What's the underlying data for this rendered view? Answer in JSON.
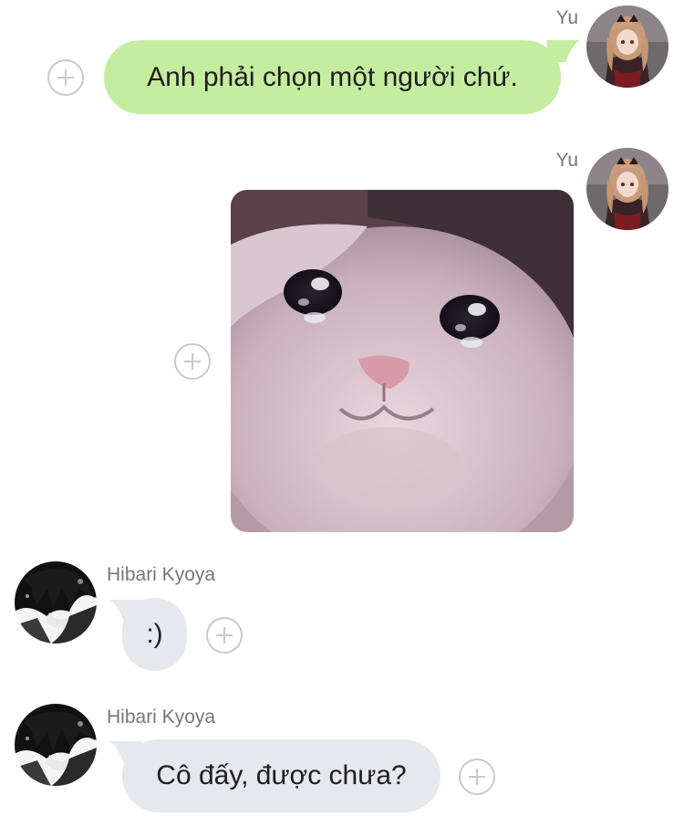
{
  "messages": [
    {
      "sender": "Yu",
      "side": "right",
      "type": "text",
      "text": "Anh phải chọn một người chứ."
    },
    {
      "sender": "Yu",
      "side": "right",
      "type": "image",
      "image_description": "crying-cat-sticker"
    },
    {
      "sender": "Hibari Kyoya",
      "side": "left",
      "type": "text",
      "text": ":)"
    },
    {
      "sender": "Hibari Kyoya",
      "side": "left",
      "type": "text",
      "text": "Cô đấy, được chưa?"
    }
  ],
  "icons": {
    "add_reaction": "plus-circle-icon",
    "avatar_yu": "anime-girl-avatar",
    "avatar_hibari": "anime-boy-avatar"
  },
  "colors": {
    "outgoing_bubble": "#c4ed9f",
    "incoming_bubble": "#e5e8ec",
    "name_text": "#777777",
    "plus_icon": "#c9c9c9"
  }
}
